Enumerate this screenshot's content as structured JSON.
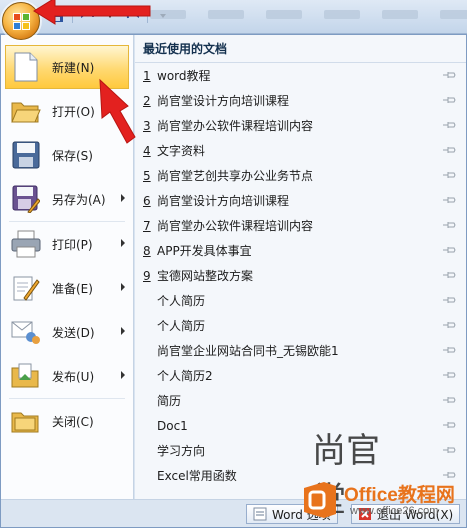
{
  "menu": {
    "items": [
      {
        "label": "新建(N)",
        "icon": "new-document-icon",
        "active": true
      },
      {
        "label": "打开(O)",
        "icon": "open-folder-icon"
      },
      {
        "label": "保存(S)",
        "icon": "save-icon"
      },
      {
        "label": "另存为(A)",
        "icon": "save-as-icon",
        "submenu": true
      },
      {
        "label": "打印(P)",
        "icon": "printer-icon",
        "submenu": true
      },
      {
        "label": "准备(E)",
        "icon": "prepare-icon",
        "submenu": true
      },
      {
        "label": "发送(D)",
        "icon": "send-icon",
        "submenu": true
      },
      {
        "label": "发布(U)",
        "icon": "publish-icon",
        "submenu": true
      },
      {
        "label": "关闭(C)",
        "icon": "close-folder-icon"
      }
    ]
  },
  "recent": {
    "title": "最近使用的文档",
    "items": [
      {
        "num": "1",
        "name": "word教程"
      },
      {
        "num": "2",
        "name": "尚官堂设计方向培训课程"
      },
      {
        "num": "3",
        "name": "尚官堂办公软件课程培训内容"
      },
      {
        "num": "4",
        "name": "文字资料"
      },
      {
        "num": "5",
        "name": "尚官堂艺创共享办公业务节点"
      },
      {
        "num": "6",
        "name": "尚官堂设计方向培训课程"
      },
      {
        "num": "7",
        "name": "尚官堂办公软件课程培训内容"
      },
      {
        "num": "8",
        "name": "APP开发具体事宜"
      },
      {
        "num": "9",
        "name": "宝德网站整改方案"
      },
      {
        "num": "",
        "name": "个人简历"
      },
      {
        "num": "",
        "name": "个人简历"
      },
      {
        "num": "",
        "name": "尚官堂企业网站合同书_无锡欧能1"
      },
      {
        "num": "",
        "name": "个人简历2"
      },
      {
        "num": "",
        "name": "简历"
      },
      {
        "num": "",
        "name": "Doc1"
      },
      {
        "num": "",
        "name": "学习方向"
      },
      {
        "num": "",
        "name": "Excel常用函数"
      }
    ]
  },
  "bottom": {
    "options_label": "Word 选项",
    "exit_label": "退出 Word(X)"
  },
  "watermark": {
    "brand": "尚官堂",
    "site": "Office教程网",
    "url": "www.office26.com"
  },
  "colors": {
    "accent_orange": "#e8731c",
    "active_highlight": "#ffd972",
    "annotation_arrow": "#e3211f"
  }
}
